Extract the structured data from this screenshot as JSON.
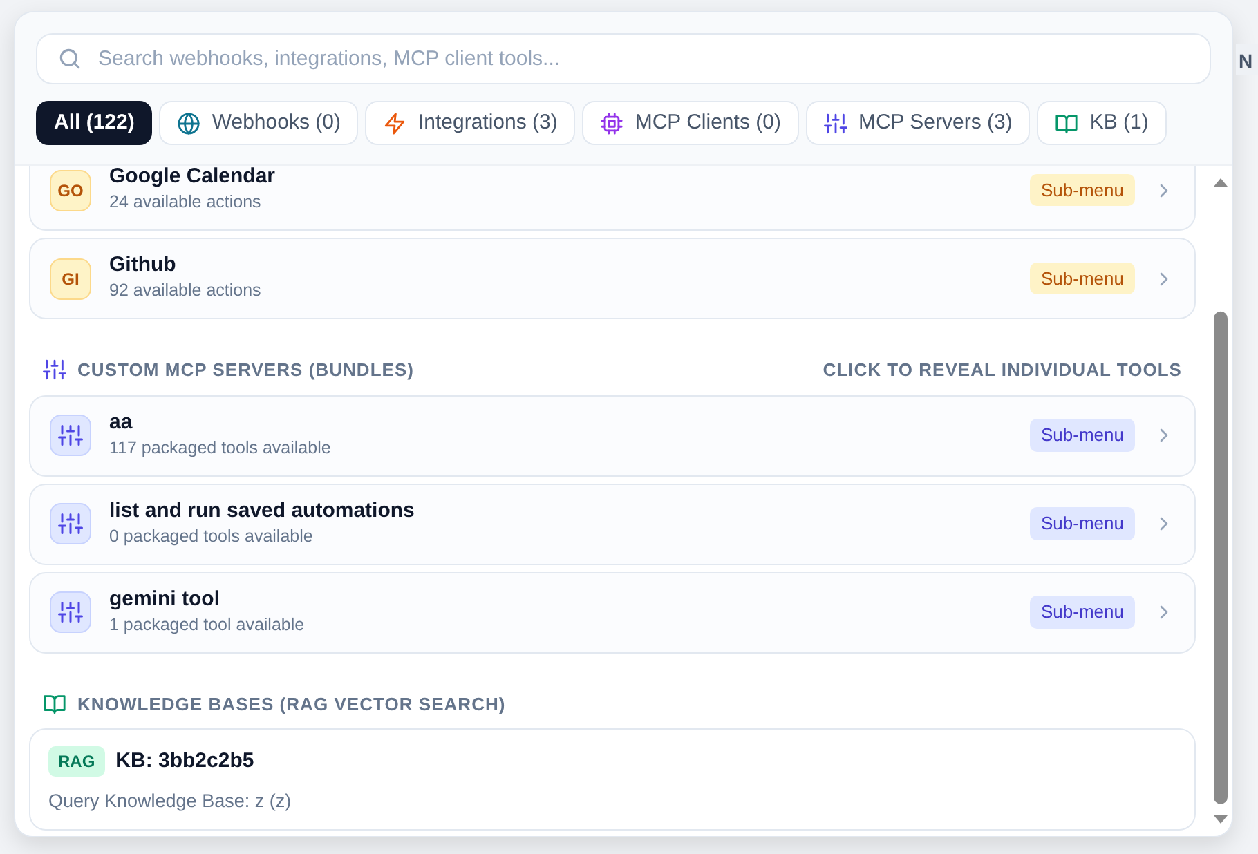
{
  "background": {
    "header_fragment": "N"
  },
  "search": {
    "placeholder": "Search webhooks, integrations, MCP client tools..."
  },
  "tabs": [
    {
      "label": "All (122)",
      "kind": "all",
      "selected": true
    },
    {
      "label": "Webhooks (0)",
      "kind": "webhook",
      "selected": false
    },
    {
      "label": "Integrations (3)",
      "kind": "integration",
      "selected": false
    },
    {
      "label": "MCP Clients (0)",
      "kind": "client",
      "selected": false
    },
    {
      "label": "MCP Servers (3)",
      "kind": "server",
      "selected": false
    },
    {
      "label": "KB (1)",
      "kind": "kb",
      "selected": false
    }
  ],
  "sections": [
    {
      "kind": "integration",
      "items": [
        {
          "initials": "GO",
          "name": "Google Calendar",
          "detail": "24 available actions",
          "badge": "Sub-menu"
        },
        {
          "initials": "GI",
          "name": "Github",
          "detail": "92 available actions",
          "badge": "Sub-menu"
        }
      ]
    },
    {
      "kind": "server",
      "title": "CUSTOM MCP SERVERS (BUNDLES)",
      "hint": "CLICK TO REVEAL INDIVIDUAL TOOLS",
      "items": [
        {
          "name": "aa",
          "detail": "117 packaged tools available",
          "badge": "Sub-menu"
        },
        {
          "name": "list and run saved automations",
          "detail": "0 packaged tools available",
          "badge": "Sub-menu"
        },
        {
          "name": "gemini tool",
          "detail": "1 packaged tool available",
          "badge": "Sub-menu"
        }
      ]
    },
    {
      "kind": "kb",
      "title": "KNOWLEDGE BASES (RAG VECTOR SEARCH)",
      "items": [
        {
          "tag": "RAG",
          "name": "KB: 3bb2c2b5",
          "detail": "Query Knowledge Base: z (z)"
        }
      ]
    }
  ]
}
